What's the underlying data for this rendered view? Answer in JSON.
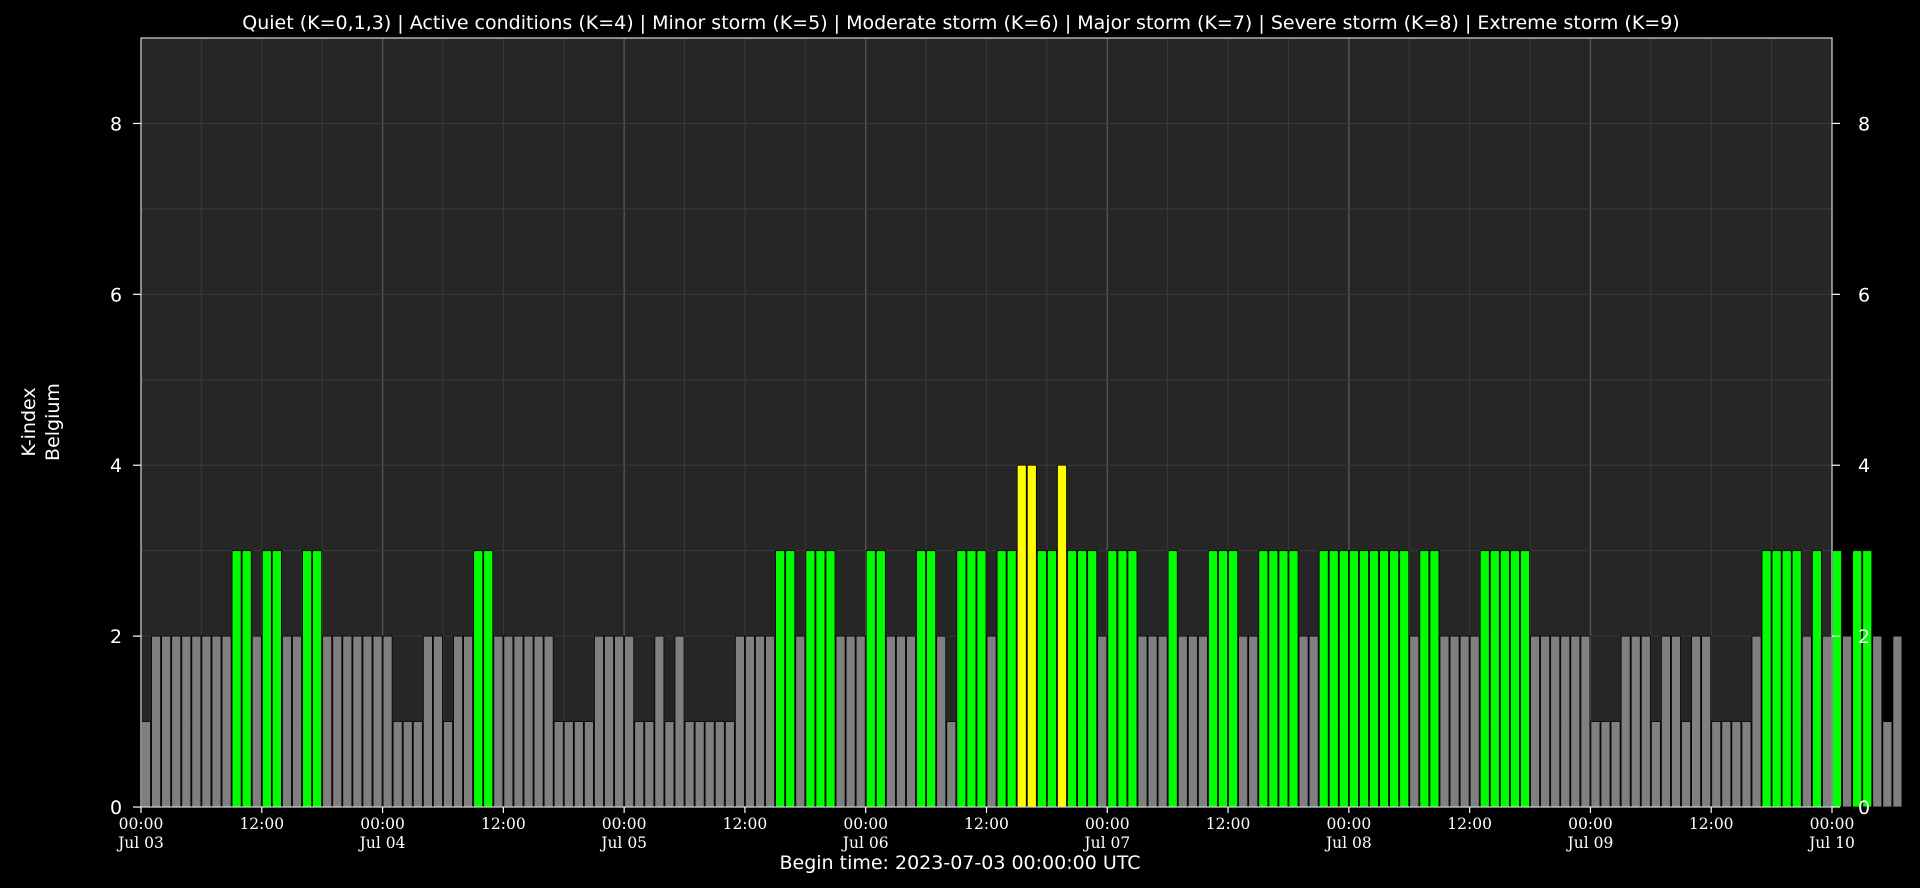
{
  "chart_data": {
    "type": "bar",
    "title": "Quiet (K=0,1,3) | Active conditions (K=4) | Minor storm (K=5) | Moderate storm (K=6) | Major storm (K=7) | Severe storm (K=8) | Extreme storm (K=9)",
    "ylabel_line1": "K-index",
    "ylabel_line2": "Belgium",
    "xlabel": "Begin time: 2023-07-03 00:00:00 UTC",
    "ylim": [
      0,
      9
    ],
    "yticks": [
      0,
      2,
      4,
      6,
      8
    ],
    "x_range_hours": [
      0,
      168
    ],
    "bar_interval_hours": 1,
    "xticks": [
      {
        "hour": 0,
        "time": "00:00",
        "date": "Jul 03"
      },
      {
        "hour": 12,
        "time": "12:00",
        "date": ""
      },
      {
        "hour": 24,
        "time": "00:00",
        "date": "Jul 04"
      },
      {
        "hour": 36,
        "time": "12:00",
        "date": ""
      },
      {
        "hour": 48,
        "time": "00:00",
        "date": "Jul 05"
      },
      {
        "hour": 60,
        "time": "12:00",
        "date": ""
      },
      {
        "hour": 72,
        "time": "00:00",
        "date": "Jul 06"
      },
      {
        "hour": 84,
        "time": "12:00",
        "date": ""
      },
      {
        "hour": 96,
        "time": "00:00",
        "date": "Jul 07"
      },
      {
        "hour": 108,
        "time": "12:00",
        "date": ""
      },
      {
        "hour": 120,
        "time": "00:00",
        "date": "Jul 08"
      },
      {
        "hour": 132,
        "time": "12:00",
        "date": ""
      },
      {
        "hour": 144,
        "time": "00:00",
        "date": "Jul 09"
      },
      {
        "hour": 156,
        "time": "12:00",
        "date": ""
      },
      {
        "hour": 168,
        "time": "00:00",
        "date": "Jul 10"
      }
    ],
    "colors": {
      "quiet": "#808080",
      "k3": "#00ff00",
      "active": "#ffff00",
      "background": "#000000",
      "plot_bg": "#262626",
      "grid": "#3a3a3a",
      "grid_major": "#555555"
    },
    "values": [
      1,
      2,
      2,
      2,
      2,
      2,
      2,
      2,
      2,
      3,
      3,
      2,
      3,
      3,
      2,
      2,
      3,
      3,
      2,
      2,
      2,
      2,
      2,
      2,
      2,
      1,
      1,
      1,
      2,
      2,
      1,
      2,
      2,
      3,
      3,
      2,
      2,
      2,
      2,
      2,
      2,
      1,
      1,
      1,
      1,
      2,
      2,
      2,
      2,
      1,
      1,
      2,
      1,
      2,
      1,
      1,
      1,
      1,
      1,
      2,
      2,
      2,
      2,
      3,
      3,
      2,
      3,
      3,
      3,
      2,
      2,
      2,
      3,
      3,
      2,
      2,
      2,
      3,
      3,
      2,
      1,
      3,
      3,
      3,
      2,
      3,
      3,
      4,
      4,
      3,
      3,
      4,
      3,
      3,
      3,
      2,
      3,
      3,
      3,
      2,
      2,
      2,
      3,
      2,
      2,
      2,
      3,
      3,
      3,
      2,
      2,
      3,
      3,
      3,
      3,
      2,
      2,
      3,
      3,
      3,
      3,
      3,
      3,
      3,
      3,
      3,
      2,
      3,
      3,
      2,
      2,
      2,
      2,
      3,
      3,
      3,
      3,
      3,
      2,
      2,
      2,
      2,
      2,
      2,
      1,
      1,
      1,
      2,
      2,
      2,
      1,
      2,
      2,
      1,
      2,
      2,
      1,
      1,
      1,
      1,
      2,
      3,
      3,
      3,
      3,
      2,
      3,
      2,
      3,
      2,
      3,
      3,
      2,
      1,
      2
    ]
  }
}
